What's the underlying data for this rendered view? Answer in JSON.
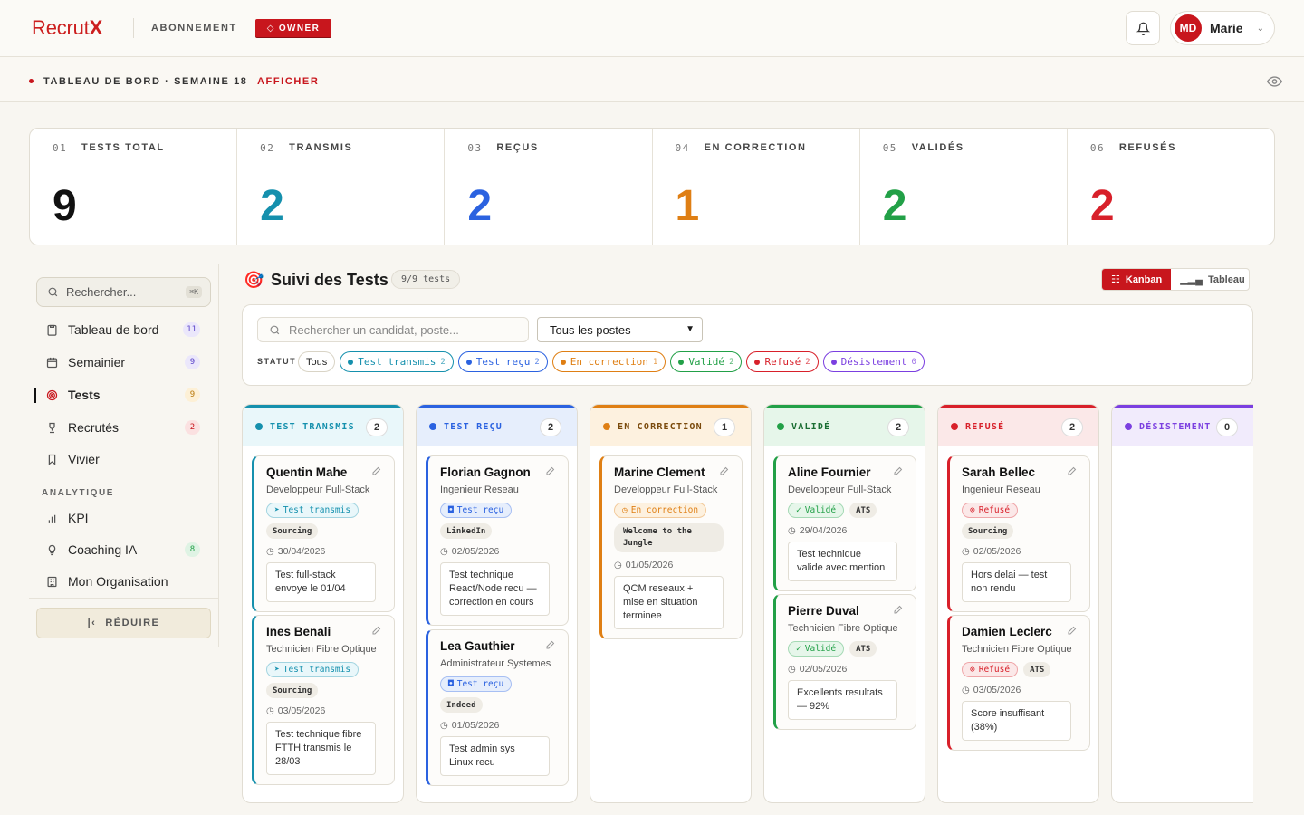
{
  "brand": {
    "logo_prefix": "Recrut",
    "logo_suffix": "X"
  },
  "header": {
    "subscription": "ABONNEMENT",
    "role_badge": "OWNER",
    "user_initials": "MD",
    "user_name": "Marie"
  },
  "subbar": {
    "title": "TABLEAU DE BORD · SEMAINE 18",
    "action": "AFFICHER"
  },
  "stats": [
    {
      "num": "01",
      "label": "TESTS TOTAL",
      "value": "9",
      "color": "#111111"
    },
    {
      "num": "02",
      "label": "TRANSMIS",
      "value": "2",
      "color": "#1590ad"
    },
    {
      "num": "03",
      "label": "REÇUS",
      "value": "2",
      "color": "#2b62e0"
    },
    {
      "num": "04",
      "label": "EN CORRECTION",
      "value": "1",
      "color": "#df7f14"
    },
    {
      "num": "05",
      "label": "VALIDÉS",
      "value": "2",
      "color": "#22a047"
    },
    {
      "num": "06",
      "label": "REFUSÉS",
      "value": "2",
      "color": "#d8202a"
    }
  ],
  "sidebar": {
    "search_placeholder": "Rechercher...",
    "search_kbd": "⌘K",
    "items": [
      {
        "label": "Tableau de bord",
        "badge": "11",
        "icon": "clipboard-icon"
      },
      {
        "label": "Semainier",
        "badge": "9",
        "icon": "calendar-icon"
      },
      {
        "label": "Tests",
        "badge": "9",
        "icon": "target-icon"
      },
      {
        "label": "Recrutés",
        "badge": "2",
        "icon": "trophy-icon"
      },
      {
        "label": "Vivier",
        "badge": "",
        "icon": "bookmark-icon"
      }
    ],
    "analytics_label": "ANALYTIQUE",
    "analytics_items": [
      {
        "label": "KPI",
        "badge": "",
        "icon": "bar-chart-icon"
      },
      {
        "label": "Coaching IA",
        "badge": "8",
        "icon": "lightbulb-icon"
      },
      {
        "label": "Mon Organisation",
        "badge": "",
        "icon": "building-icon"
      }
    ],
    "reduce_label": "RÉDUIRE"
  },
  "main": {
    "title": "Suivi des Tests",
    "count": "9/9 tests",
    "view_kanban": "Kanban",
    "view_table": "Tableau",
    "search_placeholder": "Rechercher un candidat, poste...",
    "select_value": "Tous les postes",
    "statut_label": "STATUT",
    "chips": [
      {
        "label": "Tous",
        "count": "",
        "color": ""
      },
      {
        "label": "Test transmis",
        "count": "2",
        "color": "#1590ad"
      },
      {
        "label": "Test reçu",
        "count": "2",
        "color": "#2b62e0"
      },
      {
        "label": "En correction",
        "count": "1",
        "color": "#df7f14"
      },
      {
        "label": "Validé",
        "count": "2",
        "color": "#22a047"
      },
      {
        "label": "Refusé",
        "count": "2",
        "color": "#d8202a"
      },
      {
        "label": "Désistement",
        "count": "0",
        "color": "#7b3fe0"
      }
    ]
  },
  "columns": [
    {
      "title": "TEST TRANSMIS",
      "count": "2",
      "color": "#1590ad",
      "bg": "#e9f7fa",
      "cards": [
        {
          "name": "Quentin Mahe",
          "role": "Developpeur Full-Stack",
          "status": "Test transmis",
          "tags": [
            "Sourcing"
          ],
          "date": "30/04/2026",
          "note": "Test full-stack envoye le 01/04"
        },
        {
          "name": "Ines Benali",
          "role": "Technicien Fibre Optique",
          "status": "Test transmis",
          "tags": [
            "Sourcing"
          ],
          "date": "03/05/2026",
          "note": "Test technique fibre FTTH transmis le 28/03"
        }
      ]
    },
    {
      "title": "TEST REÇU",
      "count": "2",
      "color": "#2b62e0",
      "bg": "#e6eefc",
      "cards": [
        {
          "name": "Florian Gagnon",
          "role": "Ingenieur Reseau",
          "status": "Test reçu",
          "tags": [
            "LinkedIn"
          ],
          "date": "02/05/2026",
          "note": "Test technique React/Node recu — correction en cours"
        },
        {
          "name": "Lea Gauthier",
          "role": "Administrateur Systemes",
          "status": "Test reçu",
          "tags": [
            "Indeed"
          ],
          "date": "01/05/2026",
          "note": "Test admin sys Linux recu"
        }
      ]
    },
    {
      "title": "EN CORRECTION",
      "count": "1",
      "color": "#df7f14",
      "bg": "#fdf1df",
      "cards": [
        {
          "name": "Marine Clement",
          "role": "Developpeur Full-Stack",
          "status": "En correction",
          "tags": [
            "Welcome to the Jungle"
          ],
          "date": "01/05/2026",
          "note": "QCM reseaux + mise en situation terminee"
        }
      ]
    },
    {
      "title": "VALIDÉ",
      "count": "2",
      "color": "#22a047",
      "bg": "#e6f6ea",
      "cards": [
        {
          "name": "Aline Fournier",
          "role": "Developpeur Full-Stack",
          "status": "Validé",
          "tags": [
            "ATS"
          ],
          "date": "29/04/2026",
          "note": "Test technique valide avec mention"
        },
        {
          "name": "Pierre Duval",
          "role": "Technicien Fibre Optique",
          "status": "Validé",
          "tags": [
            "ATS"
          ],
          "date": "02/05/2026",
          "note": "Excellents resultats — 92%"
        }
      ]
    },
    {
      "title": "REFUSÉ",
      "count": "2",
      "color": "#d8202a",
      "bg": "#fbe8e8",
      "cards": [
        {
          "name": "Sarah Bellec",
          "role": "Ingenieur Reseau",
          "status": "Refusé",
          "tags": [
            "Sourcing"
          ],
          "date": "02/05/2026",
          "note": "Hors delai — test non rendu"
        },
        {
          "name": "Damien Leclerc",
          "role": "Technicien Fibre Optique",
          "status": "Refusé",
          "tags": [
            "ATS"
          ],
          "date": "03/05/2026",
          "note": "Score insuffisant (38%)"
        }
      ]
    },
    {
      "title": "DÉSISTEMENT",
      "count": "0",
      "color": "#7b3fe0",
      "bg": "#f1ebfc",
      "cards": []
    }
  ]
}
